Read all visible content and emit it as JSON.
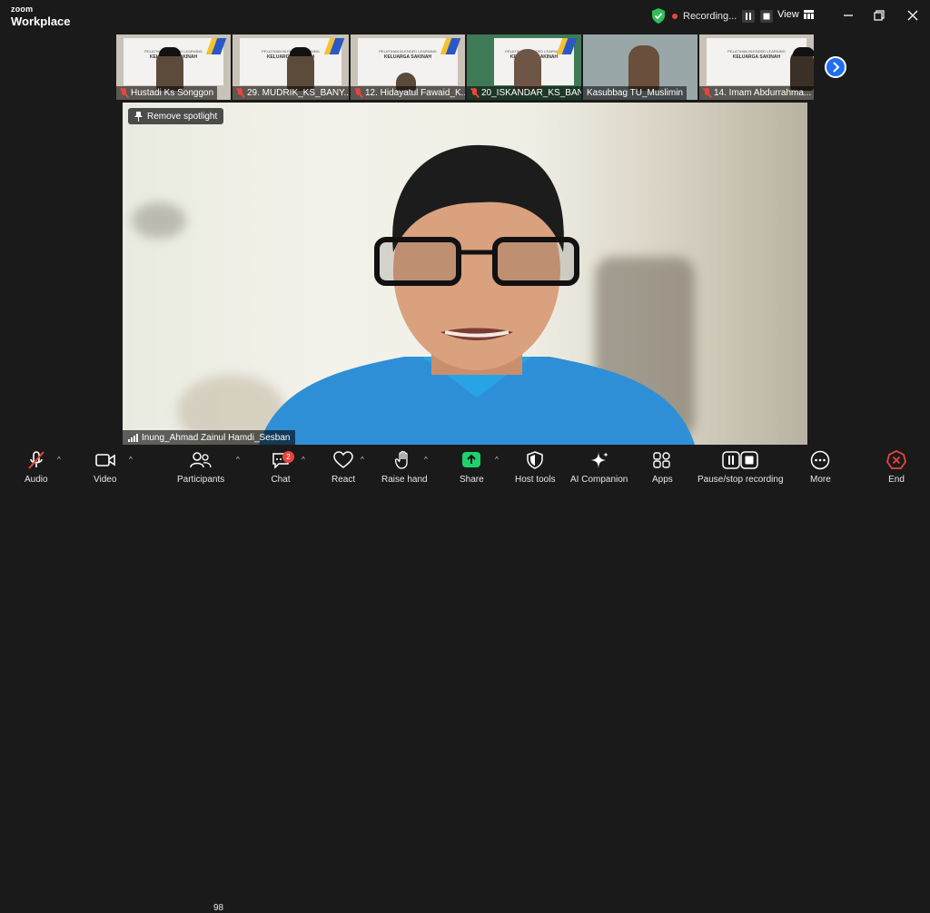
{
  "app": {
    "brand_top": "zoom",
    "brand_bottom": "Workplace"
  },
  "titlebar": {
    "recording_label": "Recording...",
    "view_label": "View"
  },
  "thumbnails": [
    {
      "name": "Hustadi Ks Songgon",
      "slide_title": "PELATIHAN BLENDED LEARNING",
      "slide_subtitle": "KELUARGA SAKINAH"
    },
    {
      "name": "29. MUDRIK_KS_BANY...",
      "slide_title": "PELATIHAN BLENDED LEARNING",
      "slide_subtitle": "KELUARGA SAKINAH"
    },
    {
      "name": "12. Hidayatul Fawaid_K...",
      "slide_title": "PELATIHAN BLENDED LEARNING",
      "slide_subtitle": "KELUARGA SAKINAH"
    },
    {
      "name": "20_ISKANDAR_KS_BAN...",
      "slide_title": "PELATIHAN BLENDED LEARNING",
      "slide_subtitle": "KELUARGA SAKINAH"
    },
    {
      "name": "Kasubbag TU_Muslimin",
      "slide_title": "",
      "slide_subtitle": ""
    },
    {
      "name": "14. Imam Abdurrahma...",
      "slide_title": "PELATIHAN BLENDED LEARNING",
      "slide_subtitle": "KELUARGA SAKINAH"
    }
  ],
  "main_video": {
    "spotlight_button": "Remove spotlight",
    "speaker_name": "Inung_Ahmad Zainul Hamdi_Sesban"
  },
  "toolbar": {
    "audio": "Audio",
    "video": "Video",
    "participants": "Participants",
    "participants_count": "98",
    "chat": "Chat",
    "chat_badge": "2",
    "react": "React",
    "raise_hand": "Raise hand",
    "share": "Share",
    "host_tools": "Host tools",
    "ai_companion": "AI Companion",
    "apps": "Apps",
    "pause_stop": "Pause/stop recording",
    "more": "More",
    "end": "End"
  },
  "colors": {
    "share_green": "#1fd16c",
    "end_red": "#e8453c",
    "shield_green": "#2fbf58",
    "accent_blue": "#1f6ef0"
  }
}
